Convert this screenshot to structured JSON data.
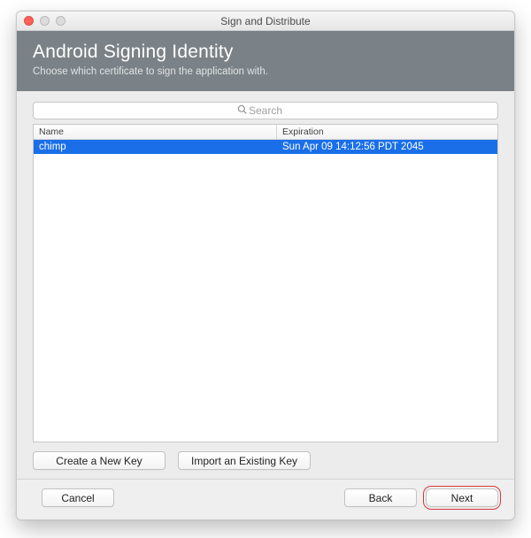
{
  "window": {
    "title": "Sign and Distribute"
  },
  "header": {
    "title": "Android Signing Identity",
    "subtitle": "Choose which certificate to sign the application with."
  },
  "search": {
    "placeholder": "Search",
    "value": ""
  },
  "table": {
    "columns": {
      "name": "Name",
      "expiration": "Expiration"
    },
    "rows": [
      {
        "name": "chimp",
        "expiration": "Sun Apr 09 14:12:56 PDT 2045",
        "selected": true
      }
    ]
  },
  "buttons": {
    "create_key": "Create a New Key",
    "import_key": "Import an Existing Key",
    "cancel": "Cancel",
    "back": "Back",
    "next": "Next"
  }
}
